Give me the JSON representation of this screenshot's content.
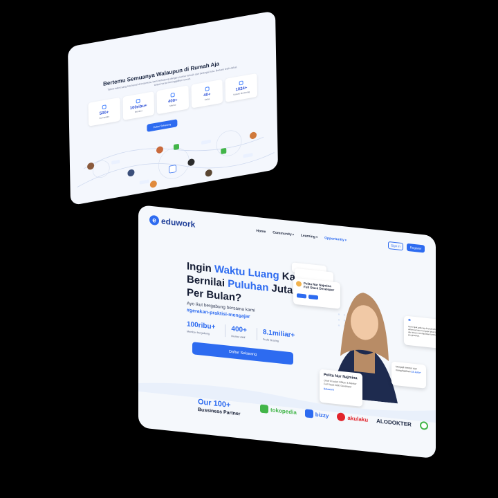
{
  "top_card": {
    "title": "Bertemu Semuanya Walaupun di Rumah Aja",
    "subtitle": "Talent-talent yang kita kenal di Indonesia, kami terhubung dengan partner terbaik dari berbagai kota. Berkarir lebih dekat, tanpa harus meninggalkan rumah.",
    "stats": [
      {
        "value": "500+",
        "label": "Komunitas",
        "icon": "wifi-icon"
      },
      {
        "value": "100ribu+",
        "label": "Member",
        "icon": "users-icon"
      },
      {
        "value": "400+",
        "label": "Mentor",
        "icon": "user-icon"
      },
      {
        "value": "40+",
        "label": "Kelas",
        "icon": "play-icon"
      },
      {
        "value": "1024+",
        "label": "Sukses Mentoring",
        "icon": "star-icon"
      }
    ],
    "button": "Daftar Sekarang"
  },
  "main_card": {
    "logo": {
      "mark": "e",
      "text": "eduwork"
    },
    "menu": [
      {
        "label": "Home",
        "active": false,
        "dropdown": false
      },
      {
        "label": "Community",
        "active": false,
        "dropdown": true
      },
      {
        "label": "Learning",
        "active": false,
        "dropdown": true
      },
      {
        "label": "Opportunity",
        "active": true,
        "dropdown": true
      }
    ],
    "sign_in": "Sign in",
    "register": "Register",
    "hero": {
      "title_parts": [
        "Ingin ",
        "Waktu Luang",
        " Kamu Bernilai ",
        "Puluhan",
        " Juta Per Bulan?"
      ],
      "subtitle": "Ayo ikut bergabung bersama kami",
      "hashtag": "#gerakan-praktisi-mengajar",
      "metrics": [
        {
          "value": "100ribu+",
          "label": "Member bergabung"
        },
        {
          "value": "400+",
          "label": "Mentor Aktif"
        },
        {
          "value": "8.1miliar+",
          "label": "Profit Sharing"
        }
      ],
      "cta": "Daftar Sekarang"
    },
    "profile_card": {
      "name": "Pelita Nur Najmina",
      "role": "Full Stack Developer"
    },
    "quote": "Semenjak gabung di Eduwork, saya akhirnya bisa mengajar jarak jauh dan tetap mendapatkan tambahan penghasilan.",
    "name_card": {
      "name": "Pelita Nur Najmina",
      "role": "Chief Product Officer & Mentor Full Stack Web Developer",
      "brand": "Eduwork"
    },
    "earn_card": {
      "text": "Menjadi mentor dan menghasilkan",
      "amount": "15 Juta+"
    },
    "partners_title": "Our 100+",
    "partners_sub": "Bussiness Partner",
    "partners": [
      {
        "name": "tokopedia",
        "color": "#42b549"
      },
      {
        "name": "bizzy",
        "color": "#2d6bf0"
      },
      {
        "name": "akulaku",
        "color": "#e2232a"
      },
      {
        "name": "ALODOKTER",
        "color": "#1f2a44"
      },
      {
        "name": "",
        "color": "#42b549"
      }
    ]
  }
}
